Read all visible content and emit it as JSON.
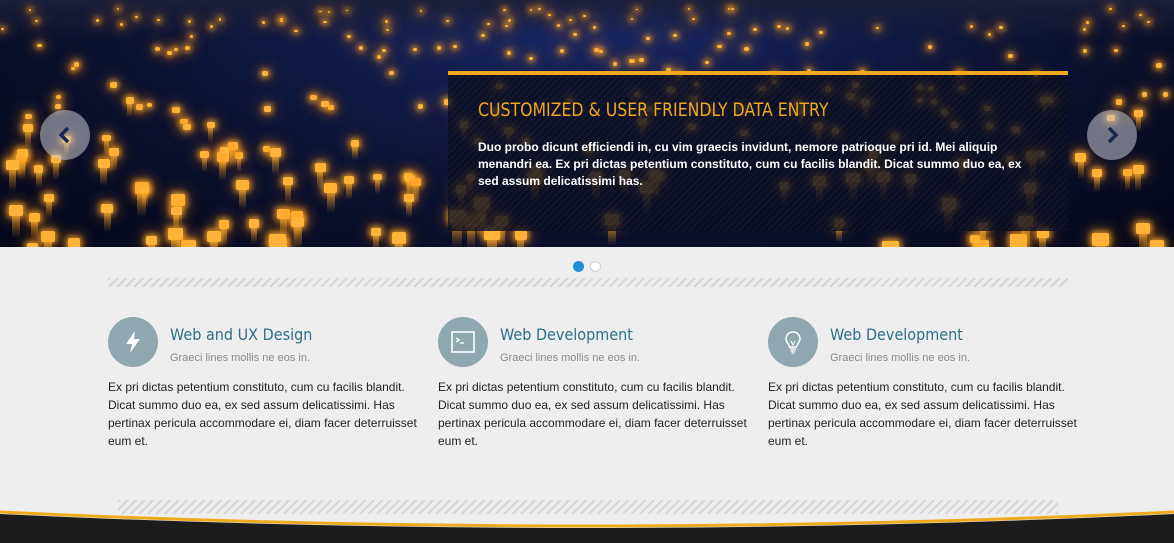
{
  "slider": {
    "caption_title": "CUSTOMIZED & USER FRIENDLY DATA ENTRY",
    "caption_text": "Duo probo dicunt efficiendi in, cu vim graecis invidunt, nemore patrioque pri id. Mei aliquip menandri ea. Ex pri dictas petentium constituto, cum cu facilis blandit. Dicat summo duo ea, ex sed assum delicatissimi has.",
    "prev_icon": "chevron-left-icon",
    "next_icon": "chevron-right-icon",
    "dots": {
      "count": 2,
      "active": 0
    },
    "colors": {
      "accent": "#f0a81c",
      "caption_bg": "#0a0e20",
      "dot_active": "#1f8fd1"
    }
  },
  "features": [
    {
      "icon": "lightning-icon",
      "title": "Web and UX Design",
      "subtitle": "Graeci lines mollis ne eos in.",
      "body": "Ex pri dictas petentium constituto, cum cu facilis blandit. Dicat summo duo ea, ex sed assum delicatissimi. Has pertinax pericula accommodare ei, diam facer deterruisset eum et."
    },
    {
      "icon": "terminal-icon",
      "title": "Web Development",
      "subtitle": "Graeci lines mollis ne eos in.",
      "body": "Ex pri dictas petentium constituto, cum cu facilis blandit. Dicat summo duo ea, ex sed assum delicatissimi. Has pertinax pericula accommodare ei, diam facer deterruisset eum et."
    },
    {
      "icon": "lightbulb-icon",
      "title": "Web Development",
      "subtitle": "Graeci lines mollis ne eos in.",
      "body": "Ex pri dictas petentium constituto, cum cu facilis blandit. Dicat summo duo ea, ex sed assum delicatissimi. Has pertinax pericula accommodare ei, diam facer deterruisset eum et."
    }
  ],
  "theme": {
    "title_color": "#2e6f86",
    "icon_bg": "#8fa7ae",
    "footer_accent": "#f0a81c"
  }
}
